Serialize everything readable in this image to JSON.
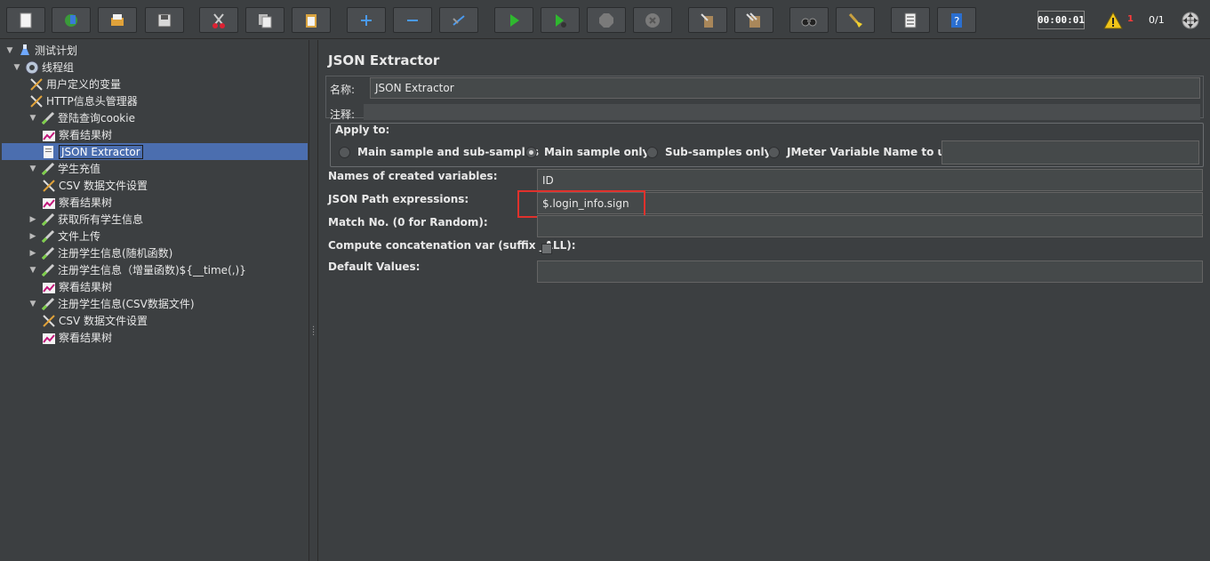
{
  "toolbar": {
    "buttons": [
      "new-icon",
      "templates-icon",
      "open-icon",
      "save-icon",
      "cut-icon",
      "copy-icon",
      "paste-icon",
      "expand-icon",
      "collapse-icon",
      "toggle-icon",
      "start-icon",
      "start-no-pause-icon",
      "stop-icon",
      "shutdown-icon",
      "clear-icon",
      "clear-all-icon",
      "search-icon",
      "reset-search-icon",
      "function-helper-icon",
      "help-icon"
    ],
    "timer": "00:00:01",
    "warning_count": "1",
    "threads": "0/1"
  },
  "tree": {
    "items": [
      {
        "label": "测试计划",
        "icon": "test-plan-icon",
        "level": 0,
        "toggle": "▼"
      },
      {
        "label": "线程组",
        "icon": "thread-group-icon",
        "level": 1,
        "toggle": "▼"
      },
      {
        "label": "用户定义的变量",
        "icon": "config-icon",
        "level": 2,
        "toggle": ""
      },
      {
        "label": "HTTP信息头管理器",
        "icon": "config-icon",
        "level": 2,
        "toggle": ""
      },
      {
        "label": "登陆查询cookie",
        "icon": "sampler-icon",
        "level": 2,
        "toggle": "▼"
      },
      {
        "label": "察看结果树",
        "icon": "listener-icon",
        "level": 3,
        "toggle": ""
      },
      {
        "label": "JSON Extractor",
        "icon": "extractor-icon",
        "level": 3,
        "toggle": "",
        "selected": true
      },
      {
        "label": "学生充值",
        "icon": "sampler-icon",
        "level": 2,
        "toggle": "▼"
      },
      {
        "label": "CSV 数据文件设置",
        "icon": "config-icon",
        "level": 3,
        "toggle": ""
      },
      {
        "label": "察看结果树",
        "icon": "listener-icon",
        "level": 3,
        "toggle": ""
      },
      {
        "label": "获取所有学生信息",
        "icon": "sampler-icon",
        "level": 2,
        "toggle": "▶"
      },
      {
        "label": "文件上传",
        "icon": "sampler-icon",
        "level": 2,
        "toggle": "▶"
      },
      {
        "label": "注册学生信息(随机函数)",
        "icon": "sampler-icon",
        "level": 2,
        "toggle": "▶"
      },
      {
        "label": "注册学生信息（增量函数)${__time(,)}",
        "icon": "sampler-icon",
        "level": 2,
        "toggle": "▼"
      },
      {
        "label": "察看结果树",
        "icon": "listener-icon",
        "level": 3,
        "toggle": ""
      },
      {
        "label": "注册学生信息(CSV数据文件)",
        "icon": "sampler-icon",
        "level": 2,
        "toggle": "▼"
      },
      {
        "label": "CSV 数据文件设置",
        "icon": "config-icon",
        "level": 3,
        "toggle": ""
      },
      {
        "label": "察看结果树",
        "icon": "listener-icon",
        "level": 3,
        "toggle": ""
      }
    ]
  },
  "panel": {
    "title": "JSON Extractor",
    "name_label": "名称:",
    "name_value": "JSON Extractor",
    "comment_label": "注释:",
    "comment_value": "",
    "apply_to": {
      "title": "Apply to:",
      "options": [
        "Main sample and sub-samples",
        "Main sample only",
        "Sub-samples only",
        "JMeter Variable Name to use"
      ],
      "selected": "Main sample only",
      "variable_value": ""
    },
    "fields": {
      "names_label": "Names of created variables:",
      "names_value": "ID",
      "path_label": "JSON Path expressions:",
      "path_value": "$.login_info.sign",
      "match_label": "Match No. (0 for Random):",
      "match_value": "",
      "concat_label": "Compute concatenation var (suffix _ALL):",
      "concat_checked": false,
      "default_label": "Default Values:",
      "default_value": ""
    }
  },
  "colors": {
    "background": "#3c3f41",
    "selection": "#4b6eaf",
    "field": "#45494a",
    "highlight": "#e0312c"
  }
}
